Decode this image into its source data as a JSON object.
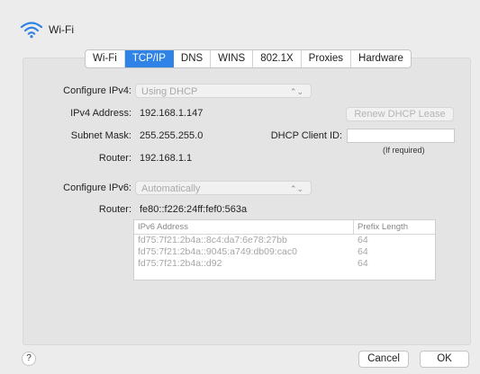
{
  "header": {
    "title": "Wi-Fi",
    "icon": "wifi-icon"
  },
  "tabs": [
    {
      "label": "Wi-Fi",
      "active": false
    },
    {
      "label": "TCP/IP",
      "active": true
    },
    {
      "label": "DNS",
      "active": false
    },
    {
      "label": "WINS",
      "active": false
    },
    {
      "label": "802.1X",
      "active": false
    },
    {
      "label": "Proxies",
      "active": false
    },
    {
      "label": "Hardware",
      "active": false
    }
  ],
  "ipv4": {
    "configure_label": "Configure IPv4:",
    "configure_value": "Using DHCP",
    "address_label": "IPv4 Address:",
    "address_value": "192.168.1.147",
    "renew_button": "Renew DHCP Lease",
    "subnet_label": "Subnet Mask:",
    "subnet_value": "255.255.255.0",
    "dhcp_client_id_label": "DHCP Client ID:",
    "dhcp_client_id_value": "",
    "dhcp_client_id_hint": "(If required)",
    "router_label": "Router:",
    "router_value": "192.168.1.1"
  },
  "ipv6": {
    "configure_label": "Configure IPv6:",
    "configure_value": "Automatically",
    "router_label": "Router:",
    "router_value": "fe80::f226:24ff:fef0:563a",
    "table": {
      "columns": [
        "IPv6 Address",
        "Prefix Length"
      ],
      "rows": [
        [
          "fd75:7f21:2b4a::8c4:da7:6e78:27bb",
          "64"
        ],
        [
          "fd75:7f21:2b4a::9045:a749:db09:cac0",
          "64"
        ],
        [
          "fd75:7f21:2b4a::d92",
          "64"
        ]
      ]
    }
  },
  "footer": {
    "help": "?",
    "cancel": "Cancel",
    "ok": "OK"
  },
  "colors": {
    "accent": "#2f82e6",
    "background": "#ececec",
    "panel": "#e4e4e4"
  }
}
